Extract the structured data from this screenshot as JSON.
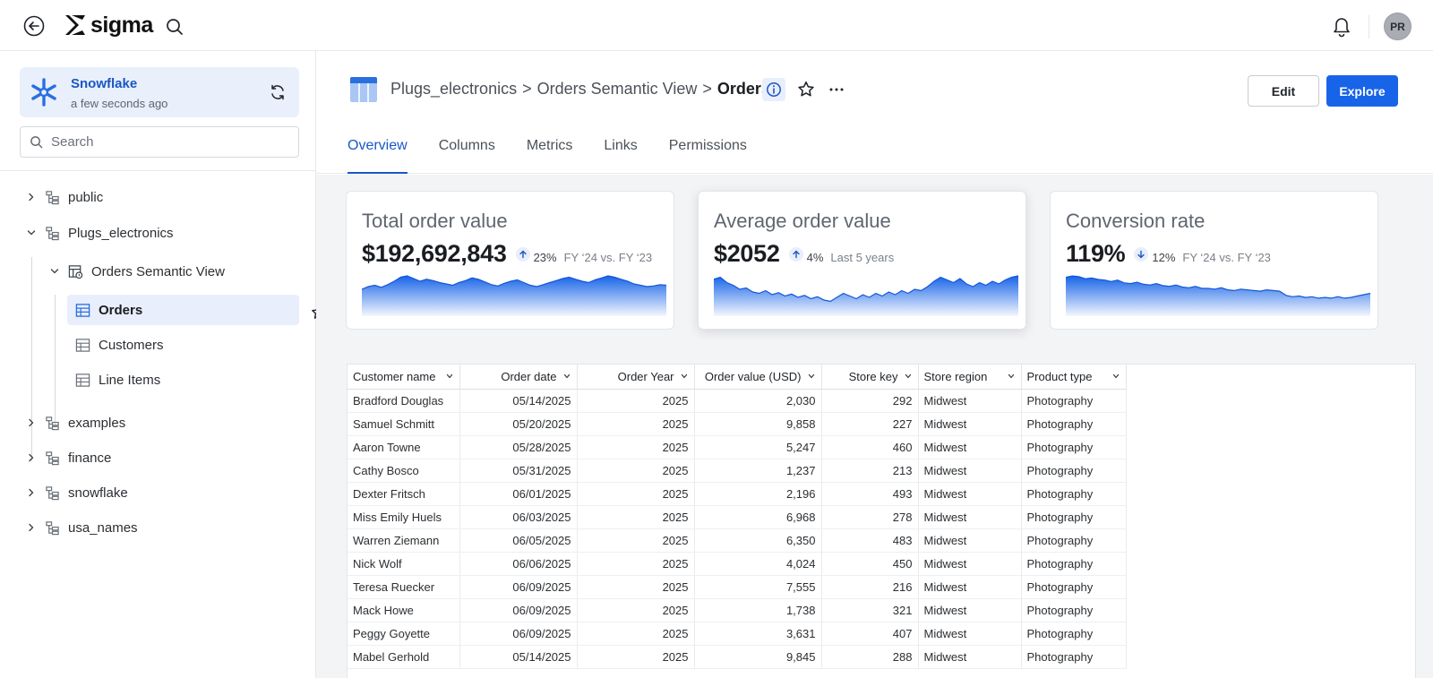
{
  "topbar": {
    "logo_text": "sigma",
    "avatar_initials": "PR"
  },
  "sidebar": {
    "connection": {
      "name": "Snowflake",
      "updated": "a few seconds ago"
    },
    "search_placeholder": "Search",
    "tree": {
      "public": "public",
      "plugs": "Plugs_electronics",
      "semantic_view": "Orders Semantic View",
      "orders": "Orders",
      "customers": "Customers",
      "line_items": "Line Items",
      "examples": "examples",
      "finance": "finance",
      "snowflake": "snowflake",
      "usa_names": "usa_names"
    }
  },
  "header": {
    "breadcrumb": [
      "Plugs_electronics",
      "Orders Semantic View",
      "Orders"
    ],
    "sep": ">",
    "edit_label": "Edit",
    "explore_label": "Explore",
    "tabs": [
      "Overview",
      "Columns",
      "Metrics",
      "Links",
      "Permissions"
    ],
    "active_tab": "Overview"
  },
  "colors": {
    "accent": "#1764e8",
    "selected_bg": "#e8eefb"
  },
  "kpis": [
    {
      "title": "Total order value",
      "value": "$192,692,843",
      "direction": "up",
      "delta": "23%",
      "period": "FY ‘24 vs. FY ‘23",
      "trend": [
        40,
        44,
        46,
        43,
        47,
        52,
        58,
        60,
        56,
        52,
        55,
        53,
        50,
        48,
        46,
        50,
        53,
        57,
        55,
        51,
        47,
        45,
        49,
        52,
        54,
        50,
        46,
        44,
        47,
        50,
        53,
        56,
        58,
        55,
        52,
        50,
        54,
        57,
        60,
        58,
        55,
        52,
        48,
        46,
        44,
        45,
        47,
        46
      ]
    },
    {
      "title": "Average order value",
      "value": "$2052",
      "direction": "up",
      "delta": "4%",
      "period": "Last 5 years",
      "trend": [
        55,
        58,
        50,
        46,
        40,
        42,
        36,
        34,
        38,
        32,
        35,
        30,
        33,
        28,
        31,
        26,
        29,
        24,
        22,
        28,
        34,
        30,
        26,
        32,
        28,
        34,
        30,
        36,
        32,
        38,
        34,
        40,
        38,
        44,
        52,
        58,
        54,
        50,
        56,
        48,
        44,
        50,
        46,
        52,
        48,
        54,
        58,
        60
      ]
    },
    {
      "title": "Conversion rate",
      "value": "119%",
      "direction": "down",
      "delta": "12%",
      "period": "FY ‘24 vs. FY ‘23",
      "trend": [
        56,
        58,
        57,
        54,
        55,
        53,
        52,
        50,
        52,
        48,
        47,
        49,
        46,
        45,
        47,
        44,
        43,
        45,
        42,
        41,
        43,
        40,
        40,
        39,
        41,
        38,
        37,
        39,
        38,
        37,
        36,
        38,
        37,
        36,
        30,
        28,
        29,
        27,
        28,
        26,
        27,
        26,
        28,
        26,
        27,
        29,
        31,
        33
      ]
    }
  ],
  "table": {
    "columns": [
      "Customer name",
      "Order date",
      "Order Year",
      "Order value (USD)",
      "Store key",
      "Store region",
      "Product type"
    ],
    "rows": [
      [
        "Bradford Douglas",
        "05/14/2025",
        "2025",
        "2,030",
        "292",
        "Midwest",
        "Photography"
      ],
      [
        "Samuel Schmitt",
        "05/20/2025",
        "2025",
        "9,858",
        "227",
        "Midwest",
        "Photography"
      ],
      [
        "Aaron Towne",
        "05/28/2025",
        "2025",
        "5,247",
        "460",
        "Midwest",
        "Photography"
      ],
      [
        "Cathy Bosco",
        "05/31/2025",
        "2025",
        "1,237",
        "213",
        "Midwest",
        "Photography"
      ],
      [
        "Dexter Fritsch",
        "06/01/2025",
        "2025",
        "2,196",
        "493",
        "Midwest",
        "Photography"
      ],
      [
        "Miss Emily Huels",
        "06/03/2025",
        "2025",
        "6,968",
        "278",
        "Midwest",
        "Photography"
      ],
      [
        "Warren Ziemann",
        "06/05/2025",
        "2025",
        "6,350",
        "483",
        "Midwest",
        "Photography"
      ],
      [
        "Nick Wolf",
        "06/06/2025",
        "2025",
        "4,024",
        "450",
        "Midwest",
        "Photography"
      ],
      [
        "Teresa Ruecker",
        "06/09/2025",
        "2025",
        "7,555",
        "216",
        "Midwest",
        "Photography"
      ],
      [
        "Mack Howe",
        "06/09/2025",
        "2025",
        "1,738",
        "321",
        "Midwest",
        "Photography"
      ],
      [
        "Peggy Goyette",
        "06/09/2025",
        "2025",
        "3,631",
        "407",
        "Midwest",
        "Photography"
      ],
      [
        "Mabel Gerhold",
        "05/14/2025",
        "2025",
        "9,845",
        "288",
        "Midwest",
        "Photography"
      ]
    ]
  }
}
